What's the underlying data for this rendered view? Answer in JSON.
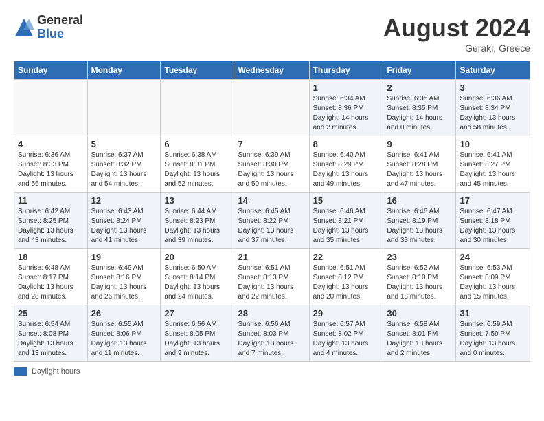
{
  "header": {
    "logo_general": "General",
    "logo_blue": "Blue",
    "month_year": "August 2024",
    "location": "Geraki, Greece"
  },
  "footer": {
    "label": "Daylight hours"
  },
  "days_of_week": [
    "Sunday",
    "Monday",
    "Tuesday",
    "Wednesday",
    "Thursday",
    "Friday",
    "Saturday"
  ],
  "weeks": [
    [
      {
        "day": "",
        "info": ""
      },
      {
        "day": "",
        "info": ""
      },
      {
        "day": "",
        "info": ""
      },
      {
        "day": "",
        "info": ""
      },
      {
        "day": "1",
        "info": "Sunrise: 6:34 AM\nSunset: 8:36 PM\nDaylight: 14 hours\nand 2 minutes."
      },
      {
        "day": "2",
        "info": "Sunrise: 6:35 AM\nSunset: 8:35 PM\nDaylight: 14 hours\nand 0 minutes."
      },
      {
        "day": "3",
        "info": "Sunrise: 6:36 AM\nSunset: 8:34 PM\nDaylight: 13 hours\nand 58 minutes."
      }
    ],
    [
      {
        "day": "4",
        "info": "Sunrise: 6:36 AM\nSunset: 8:33 PM\nDaylight: 13 hours\nand 56 minutes."
      },
      {
        "day": "5",
        "info": "Sunrise: 6:37 AM\nSunset: 8:32 PM\nDaylight: 13 hours\nand 54 minutes."
      },
      {
        "day": "6",
        "info": "Sunrise: 6:38 AM\nSunset: 8:31 PM\nDaylight: 13 hours\nand 52 minutes."
      },
      {
        "day": "7",
        "info": "Sunrise: 6:39 AM\nSunset: 8:30 PM\nDaylight: 13 hours\nand 50 minutes."
      },
      {
        "day": "8",
        "info": "Sunrise: 6:40 AM\nSunset: 8:29 PM\nDaylight: 13 hours\nand 49 minutes."
      },
      {
        "day": "9",
        "info": "Sunrise: 6:41 AM\nSunset: 8:28 PM\nDaylight: 13 hours\nand 47 minutes."
      },
      {
        "day": "10",
        "info": "Sunrise: 6:41 AM\nSunset: 8:27 PM\nDaylight: 13 hours\nand 45 minutes."
      }
    ],
    [
      {
        "day": "11",
        "info": "Sunrise: 6:42 AM\nSunset: 8:25 PM\nDaylight: 13 hours\nand 43 minutes."
      },
      {
        "day": "12",
        "info": "Sunrise: 6:43 AM\nSunset: 8:24 PM\nDaylight: 13 hours\nand 41 minutes."
      },
      {
        "day": "13",
        "info": "Sunrise: 6:44 AM\nSunset: 8:23 PM\nDaylight: 13 hours\nand 39 minutes."
      },
      {
        "day": "14",
        "info": "Sunrise: 6:45 AM\nSunset: 8:22 PM\nDaylight: 13 hours\nand 37 minutes."
      },
      {
        "day": "15",
        "info": "Sunrise: 6:46 AM\nSunset: 8:21 PM\nDaylight: 13 hours\nand 35 minutes."
      },
      {
        "day": "16",
        "info": "Sunrise: 6:46 AM\nSunset: 8:19 PM\nDaylight: 13 hours\nand 33 minutes."
      },
      {
        "day": "17",
        "info": "Sunrise: 6:47 AM\nSunset: 8:18 PM\nDaylight: 13 hours\nand 30 minutes."
      }
    ],
    [
      {
        "day": "18",
        "info": "Sunrise: 6:48 AM\nSunset: 8:17 PM\nDaylight: 13 hours\nand 28 minutes."
      },
      {
        "day": "19",
        "info": "Sunrise: 6:49 AM\nSunset: 8:16 PM\nDaylight: 13 hours\nand 26 minutes."
      },
      {
        "day": "20",
        "info": "Sunrise: 6:50 AM\nSunset: 8:14 PM\nDaylight: 13 hours\nand 24 minutes."
      },
      {
        "day": "21",
        "info": "Sunrise: 6:51 AM\nSunset: 8:13 PM\nDaylight: 13 hours\nand 22 minutes."
      },
      {
        "day": "22",
        "info": "Sunrise: 6:51 AM\nSunset: 8:12 PM\nDaylight: 13 hours\nand 20 minutes."
      },
      {
        "day": "23",
        "info": "Sunrise: 6:52 AM\nSunset: 8:10 PM\nDaylight: 13 hours\nand 18 minutes."
      },
      {
        "day": "24",
        "info": "Sunrise: 6:53 AM\nSunset: 8:09 PM\nDaylight: 13 hours\nand 15 minutes."
      }
    ],
    [
      {
        "day": "25",
        "info": "Sunrise: 6:54 AM\nSunset: 8:08 PM\nDaylight: 13 hours\nand 13 minutes."
      },
      {
        "day": "26",
        "info": "Sunrise: 6:55 AM\nSunset: 8:06 PM\nDaylight: 13 hours\nand 11 minutes."
      },
      {
        "day": "27",
        "info": "Sunrise: 6:56 AM\nSunset: 8:05 PM\nDaylight: 13 hours\nand 9 minutes."
      },
      {
        "day": "28",
        "info": "Sunrise: 6:56 AM\nSunset: 8:03 PM\nDaylight: 13 hours\nand 7 minutes."
      },
      {
        "day": "29",
        "info": "Sunrise: 6:57 AM\nSunset: 8:02 PM\nDaylight: 13 hours\nand 4 minutes."
      },
      {
        "day": "30",
        "info": "Sunrise: 6:58 AM\nSunset: 8:01 PM\nDaylight: 13 hours\nand 2 minutes."
      },
      {
        "day": "31",
        "info": "Sunrise: 6:59 AM\nSunset: 7:59 PM\nDaylight: 13 hours\nand 0 minutes."
      }
    ]
  ]
}
